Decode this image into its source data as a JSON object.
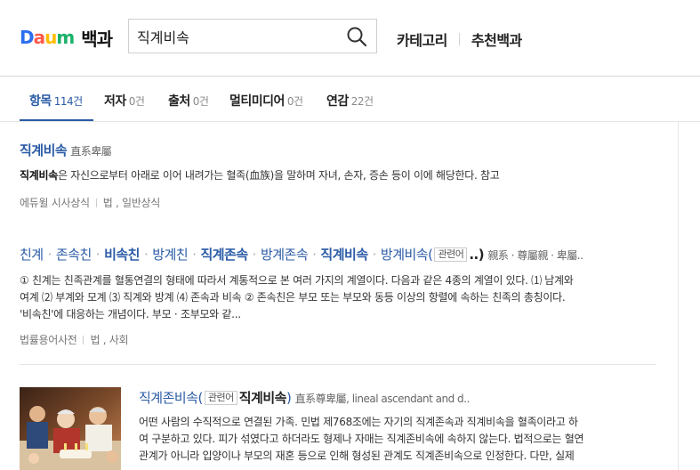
{
  "header": {
    "logo_daum": [
      "D",
      "a",
      "u",
      "m"
    ],
    "logo_title": "백과",
    "search_value": "직계비속",
    "links": [
      "카테고리",
      "추천백과"
    ]
  },
  "tabs": [
    {
      "label": "항목",
      "count": "114건",
      "active": true
    },
    {
      "label": "저자",
      "count": "0건"
    },
    {
      "label": "출처",
      "count": "0건"
    },
    {
      "label": "멀티미디어",
      "count": "0건"
    },
    {
      "label": "연감",
      "count": "22건"
    }
  ],
  "results": [
    {
      "title": "직계비속",
      "hanja": "直系卑屬",
      "desc_bold": "직계비속",
      "desc_rest": "은 자신으로부터 아래로 이어 내려가는 혈족(血族)을 말하며 자녀, 손자, 증손 등이 이에 해당한다. 참고",
      "source": "에듀윌 시사상식",
      "category": "법 , 일반상식"
    },
    {
      "title_parts": [
        "친계",
        "존속친",
        "비속친",
        "방계친",
        "직계존속",
        "방계존속",
        "직계비속",
        "방계비속"
      ],
      "rel_tag": "관련어",
      "rel_tail": "..)",
      "hanja": "親系 · 尊屬親 · 卑屬..",
      "desc_lines": [
        "① 친계는 친족관계를 혈통연결의 형태에 따라서 계통적으로 본 여러 가지의 계열이다. 다음과 같은 4종의 계열이 있다. ⑴ 남계와",
        "여계 ⑵ 부계와 모계 ⑶ 직계와 방계 ⑷ 존속과 비속 ② 존속친은 부모 또는 부모와 동등 이상의 항렬에 속하는 친족의 총칭이다.",
        "'비속친'에 대응하는 개념이다. 부모 · 조부모와 같..."
      ],
      "source": "법률용어사전",
      "category": "법 , 사회"
    },
    {
      "title": "직계존비속",
      "rel_tag": "관련어",
      "rel_word": "직계비속",
      "hanja": "直系尊卑屬, lineal ascendant and d..",
      "desc_lines": [
        "어떤 사람의 수직적으로 연결된 가족. 민법 제768조에는 자기의 직계존속과 직계비속을 혈족이라고 하",
        "여 구분하고 있다. 피가 섞였다고 하더라도 형제나 자매는 직계존비속에 속하지 않는다. 법적으로는 혈연",
        "관계가 아니라 입양이나 부모의 재혼 등으로 인해 형성된 관계도 직계존비속으로 인정한다. 다만, 실제"
      ]
    }
  ]
}
